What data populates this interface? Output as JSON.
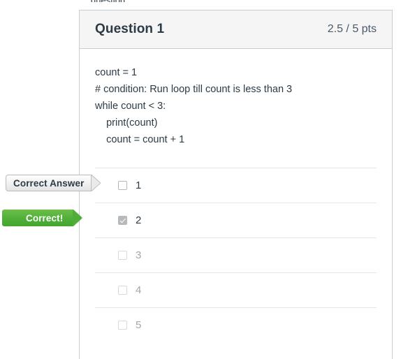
{
  "page": {
    "top_fragment": "question"
  },
  "question": {
    "title": "Question 1",
    "points": "2.5 / 5 pts",
    "code_lines": [
      "count = 1",
      "# condition: Run loop till count is less than 3",
      "while count < 3:",
      "    print(count)",
      "    count = count + 1"
    ],
    "answers": [
      {
        "label": "1",
        "checked": false,
        "dimmed": false
      },
      {
        "label": "2",
        "checked": true,
        "dimmed": false
      },
      {
        "label": "3",
        "checked": false,
        "dimmed": true
      },
      {
        "label": "4",
        "checked": false,
        "dimmed": true
      },
      {
        "label": "5",
        "checked": false,
        "dimmed": true
      }
    ]
  },
  "banners": {
    "correct_answer_label": "Correct Answer",
    "correct_label": "Correct!"
  },
  "colors": {
    "green": "#52b03a",
    "header_bg": "#f5f5f5",
    "border": "#c7cdd1",
    "text": "#2d3b45",
    "dim_text": "#a0a8ad"
  }
}
